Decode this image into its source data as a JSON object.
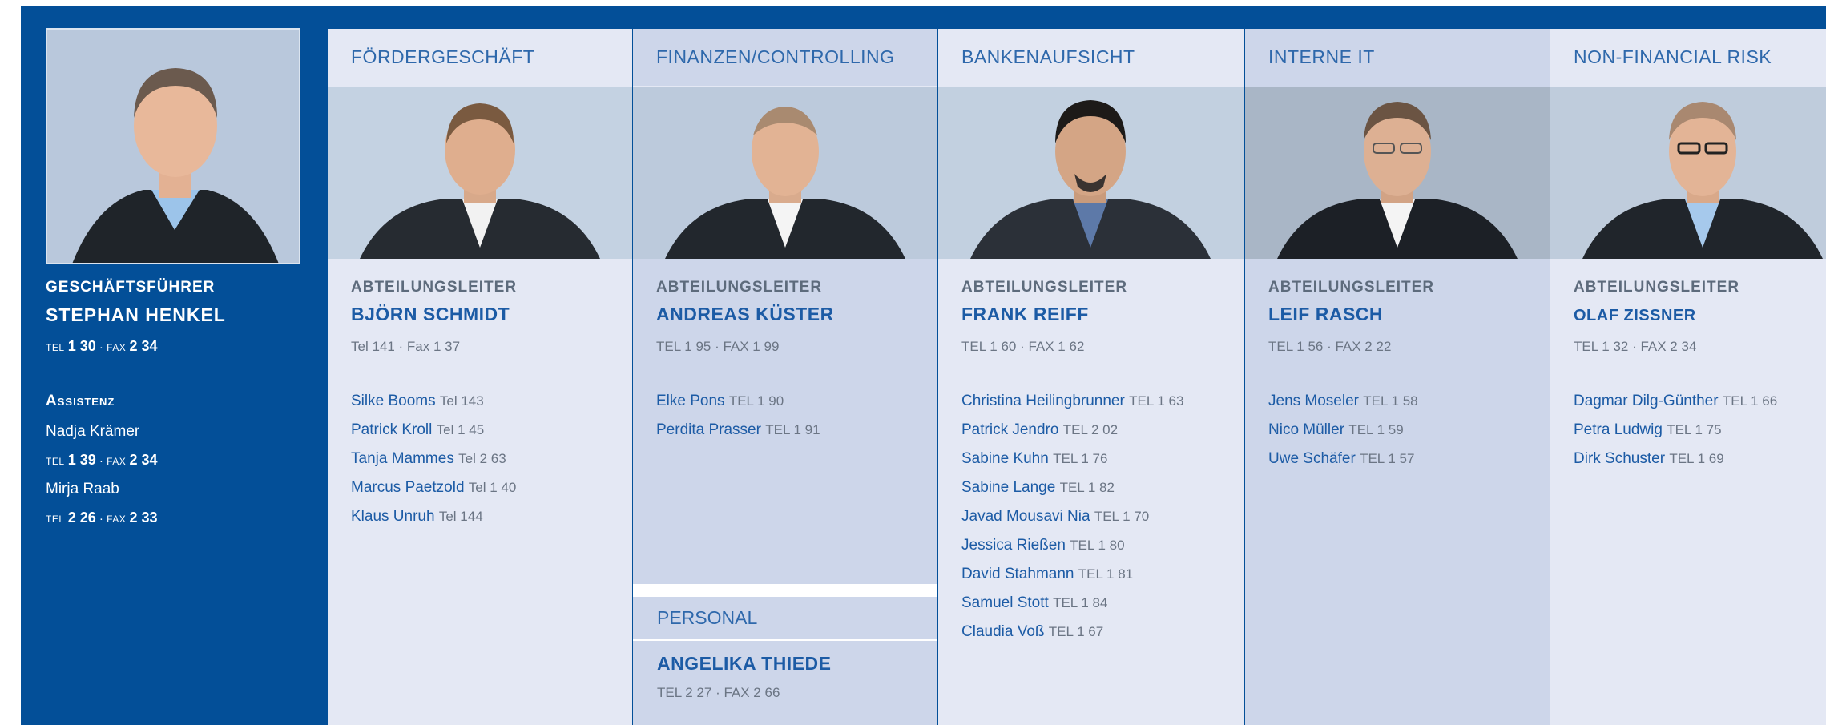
{
  "ceo": {
    "role": "GESCHÄFTSFÜHRER",
    "name": "STEPHAN HENKEL",
    "tel_label": "TEL",
    "tel": "1 30",
    "fax_label": "FAX",
    "fax": "2 34",
    "assist_heading": "Assistenz",
    "assistants": [
      {
        "name": "Nadja Krämer",
        "tel": "1 39",
        "fax": "2 34"
      },
      {
        "name": "Mirja Raab",
        "tel": "2 26",
        "fax": "2 33"
      }
    ]
  },
  "departments": [
    {
      "title": "FÖRDERGESCHÄFT",
      "role": "ABTEILUNGSLEITER",
      "lead": "BJÖRN SCHMIDT",
      "lead_tel": "Tel 141 · Fax 1 37",
      "staff": [
        {
          "name": "Silke Booms",
          "tel": "Tel 143"
        },
        {
          "name": "Patrick Kroll",
          "tel": "Tel 1 45"
        },
        {
          "name": "Tanja Mammes",
          "tel": "Tel 2 63"
        },
        {
          "name": "Marcus Paetzold",
          "tel": "Tel 1 40"
        },
        {
          "name": "Klaus Unruh",
          "tel": "Tel 144"
        }
      ]
    },
    {
      "title": "FINANZEN/CONTROLLING",
      "role": "ABTEILUNGSLEITER",
      "lead": "ANDREAS KÜSTER",
      "lead_tel": "TEL 1 95 · FAX 1 99",
      "staff": [
        {
          "name": "Elke Pons",
          "tel": "TEL 1 90"
        },
        {
          "name": "Perdita Prasser",
          "tel": "TEL 1 91"
        }
      ]
    },
    {
      "title": "BANKENAUFSICHT",
      "role": "ABTEILUNGSLEITER",
      "lead": "FRANK REIFF",
      "lead_tel": "TEL 1 60 · FAX 1 62",
      "staff": [
        {
          "name": "Christina Heilingbrunner",
          "tel": "TEL 1 63"
        },
        {
          "name": "Patrick Jendro",
          "tel": "TEL 2 02"
        },
        {
          "name": "Sabine Kuhn",
          "tel": "TEL 1 76"
        },
        {
          "name": "Sabine Lange",
          "tel": "TEL 1 82"
        },
        {
          "name": "Javad Mousavi Nia",
          "tel": "TEL 1 70"
        },
        {
          "name": "Jessica Rießen",
          "tel": "TEL 1 80"
        },
        {
          "name": "David Stahmann",
          "tel": "TEL 1 81"
        },
        {
          "name": "Samuel Stott",
          "tel": "TEL 1 84"
        },
        {
          "name": "Claudia Voß",
          "tel": "TEL 1 67"
        }
      ]
    },
    {
      "title": "INTERNE IT",
      "role": "ABTEILUNGSLEITER",
      "lead": "LEIF RASCH",
      "lead_tel": "TEL 1 56 · FAX 2 22",
      "staff": [
        {
          "name": "Jens Moseler",
          "tel": "TEL 1 58"
        },
        {
          "name": "Nico Müller",
          "tel": "TEL 1 59"
        },
        {
          "name": "Uwe Schäfer",
          "tel": "TEL 1 57"
        }
      ]
    },
    {
      "title": "NON-FINANCIAL RISK",
      "role": "ABTEILUNGSLEITER",
      "lead": "OLAF ZISSNER",
      "lead_tel": "TEL 1 32 · FAX 2 34",
      "staff": [
        {
          "name": "Dagmar Dilg-Günther",
          "tel": "TEL 1 66"
        },
        {
          "name": "Petra Ludwig",
          "tel": "TEL 1 75"
        },
        {
          "name": "Dirk Schuster",
          "tel": "TEL 1 69"
        }
      ]
    }
  ],
  "personal": {
    "title": "PERSONAL",
    "lead": "ANGELIKA THIEDE",
    "lead_tel": "TEL 2 27 · FAX 2 66"
  },
  "colors": {
    "brand_blue": "#034f98",
    "col_light": "#e4e8f4",
    "col_dark": "#cdd6ea",
    "link_blue": "#1c5ba5"
  }
}
